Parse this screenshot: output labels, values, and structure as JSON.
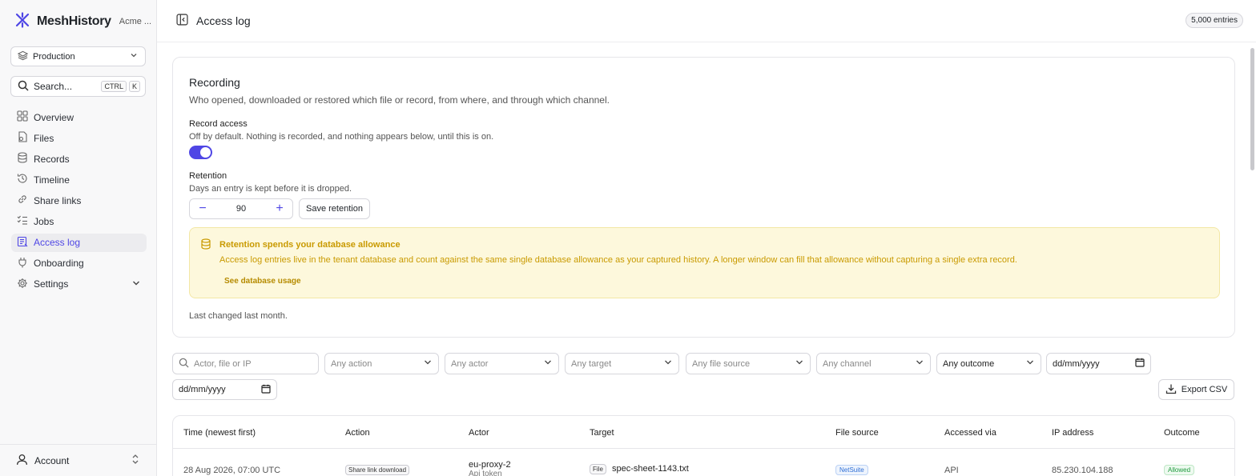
{
  "brand": {
    "name": "MeshHistory",
    "org": "Acme ...",
    "accent": "#4f46e5"
  },
  "environment": {
    "selected": "Production"
  },
  "search": {
    "placeholder": "Search...",
    "kbd1": "CTRL",
    "kbd2": "K"
  },
  "nav": [
    {
      "label": "Overview",
      "icon": "grid-icon"
    },
    {
      "label": "Files",
      "icon": "files-icon"
    },
    {
      "label": "Records",
      "icon": "database-icon"
    },
    {
      "label": "Timeline",
      "icon": "history-icon"
    },
    {
      "label": "Share links",
      "icon": "link-icon"
    },
    {
      "label": "Jobs",
      "icon": "list-check-icon"
    },
    {
      "label": "Access log",
      "icon": "log-icon",
      "active": true
    },
    {
      "label": "Onboarding",
      "icon": "plug-icon"
    },
    {
      "label": "Settings",
      "icon": "gear-icon"
    }
  ],
  "account": {
    "label": "Account"
  },
  "header": {
    "title": "Access log",
    "entries_badge": "5,000 entries"
  },
  "recording": {
    "title": "Recording",
    "description": "Who opened, downloaded or restored which file or record, from where, and through which channel.",
    "record_access_label": "Record access",
    "record_access_hint": "Off by default. Nothing is recorded, and nothing appears below, until this is on.",
    "record_access_on": true,
    "retention_label": "Retention",
    "retention_hint": "Days an entry is kept before it is dropped.",
    "retention_value": "90",
    "save_retention": "Save retention",
    "alert_title": "Retention spends your database allowance",
    "alert_body": "Access log entries live in the tenant database and count against the same single database allowance as your captured history. A longer window can fill that allowance without capturing a single extra record.",
    "alert_link": "See database usage",
    "last_changed": "Last changed last month."
  },
  "filters": {
    "search_placeholder": "Actor, file or IP",
    "action": "Any action",
    "actor": "Any actor",
    "target": "Any target",
    "file_source": "Any file source",
    "channel": "Any channel",
    "outcome": "Any outcome",
    "date_from": "dd/mm/yyyy",
    "date_to": "dd/mm/yyyy",
    "export": "Export CSV"
  },
  "table": {
    "columns": [
      "Time (newest first)",
      "Action",
      "Actor",
      "Target",
      "File source",
      "Accessed via",
      "IP address",
      "Outcome"
    ],
    "rows": [
      {
        "time": "28 Aug 2026, 07:00 UTC",
        "action": "Share link download",
        "actor": "eu-proxy-2",
        "actor_sub": "Api token",
        "target_kind": "File",
        "target": "spec-sheet-1143.txt",
        "file_source": "NetSuite",
        "via": "API",
        "ip": "85.230.104.188",
        "outcome": "Allowed"
      }
    ]
  }
}
